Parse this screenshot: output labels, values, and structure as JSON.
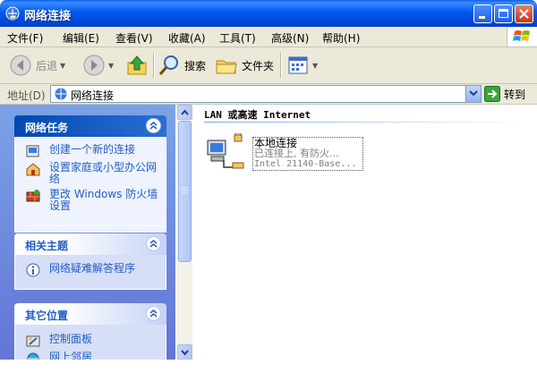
{
  "window": {
    "title": "网络连接"
  },
  "menu": [
    "文件(F)",
    "编辑(E)",
    "查看(V)",
    "收藏(A)",
    "工具(T)",
    "高级(N)",
    "帮助(H)"
  ],
  "toolbar": {
    "back": "后退",
    "search": "搜索",
    "folders": "文件夹"
  },
  "address": {
    "label": "地址(D)",
    "value": "网络连接",
    "go": "转到"
  },
  "taskpane": {
    "network_tasks": {
      "title": "网络任务",
      "items": [
        "创建一个新的连接",
        "设置家庭或小型办公网络",
        "更改 Windows 防火墙设置"
      ]
    },
    "related": {
      "title": "相关主题",
      "items": [
        "网络疑难解答程序"
      ]
    },
    "other": {
      "title": "其它位置",
      "items": [
        "控制面板",
        "网上邻居"
      ]
    }
  },
  "content": {
    "group_title": "LAN 或高速 Internet",
    "connection": {
      "name": "本地连接",
      "status": "已连接上, 有防火...",
      "device": "Intel 21140-Base..."
    }
  }
}
